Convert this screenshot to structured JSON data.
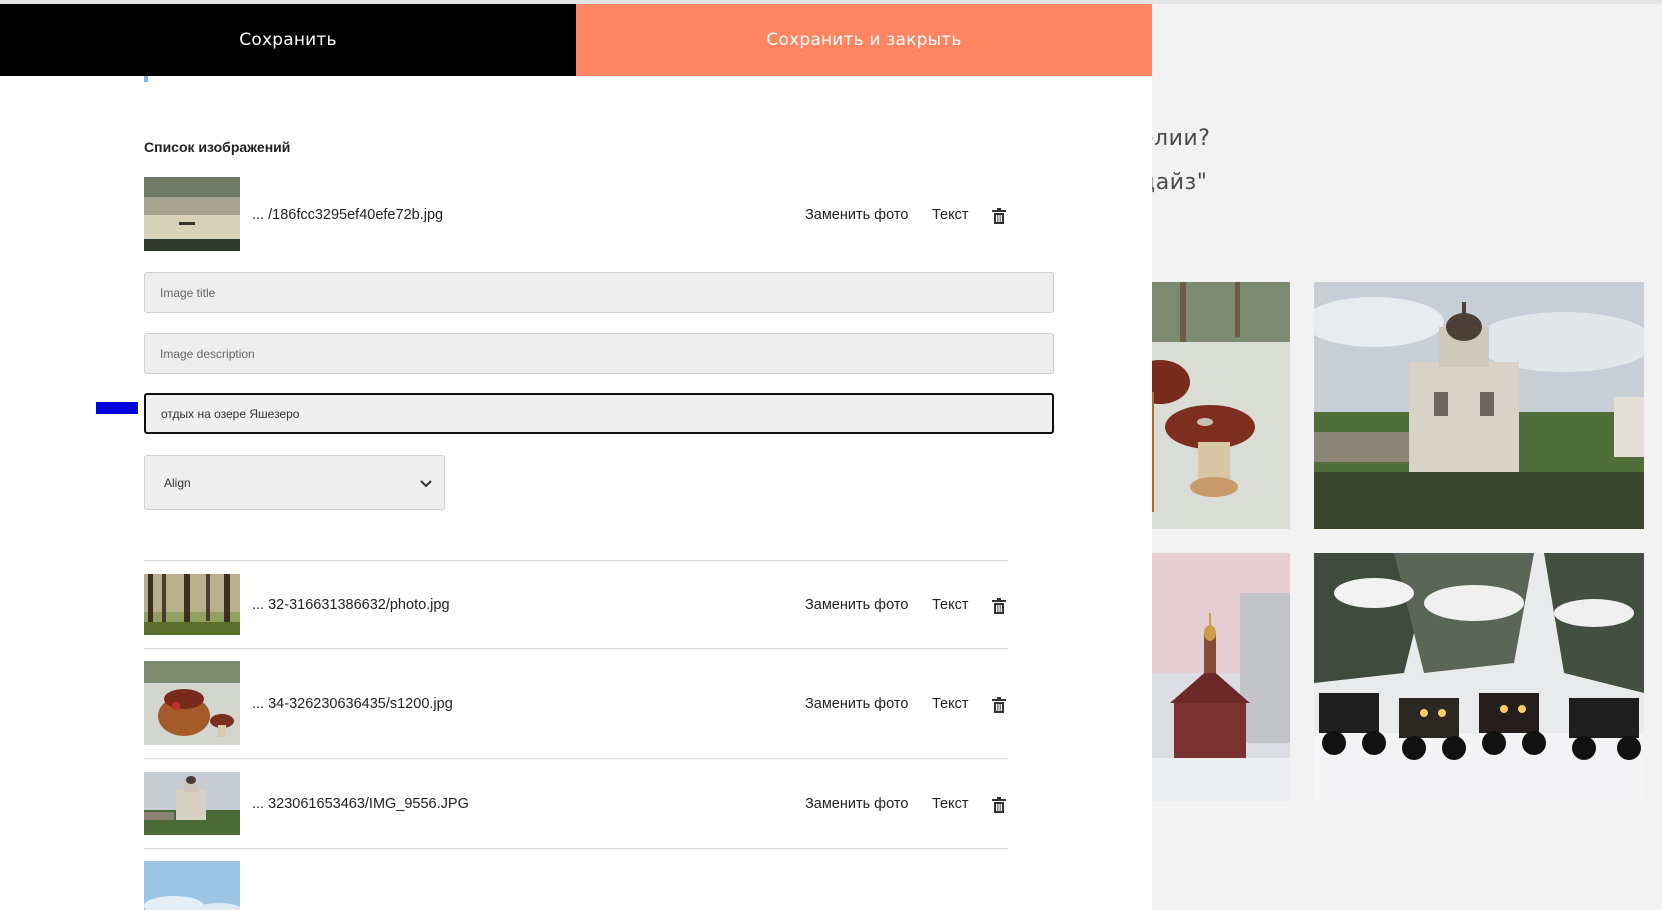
{
  "topbar": {
    "save_label": "Сохранить",
    "save_close_label": "Сохранить и закрыть"
  },
  "background_page": {
    "heading_line_1": "елии?",
    "heading_line_2": "дайз\""
  },
  "image_list": {
    "title": "Список изображений",
    "replace_label": "Заменить фото",
    "text_label": "Текст",
    "items": [
      {
        "file": "... /186fcc3295ef40efe72b.jpg",
        "thumb_icon": "lake-fog-photo"
      },
      {
        "file": "... 32-316631386632/photo.jpg",
        "thumb_icon": "forest-photo"
      },
      {
        "file": "... 34-326230636435/s1200.jpg",
        "thumb_icon": "mushroom-basket-photo"
      },
      {
        "file": "... 323061653463/IMG_9556.JPG",
        "thumb_icon": "church-ruin-photo"
      },
      {
        "file": "",
        "thumb_icon": "sky-photo"
      }
    ]
  },
  "form": {
    "title_placeholder": "Image title",
    "description_placeholder": "Image description",
    "alt_value": "отдых на озере Яшезеро",
    "align_label": "Align"
  },
  "colors": {
    "save_bg": "#000000",
    "save_close_bg": "#ff8562",
    "focus_marker": "#0000dd"
  }
}
